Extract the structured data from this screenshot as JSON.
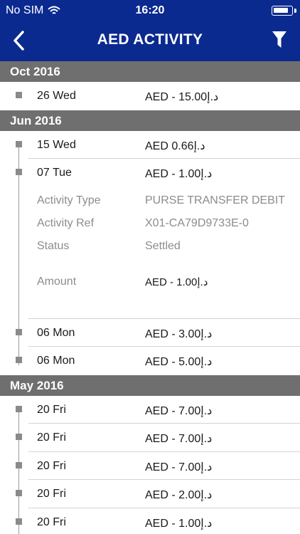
{
  "status_bar": {
    "carrier": "No SIM",
    "time": "16:20"
  },
  "header": {
    "title": "AED ACTIVITY"
  },
  "sections": [
    {
      "title": "Oct 2016",
      "rows": [
        {
          "date": "26 Wed",
          "amount": "AED - 15.00د.إ"
        }
      ]
    },
    {
      "title": "Jun 2016",
      "rows": [
        {
          "date": "15 Wed",
          "amount": "AED 0.66د.إ"
        },
        {
          "date": "07 Tue",
          "amount": "AED - 1.00د.إ"
        },
        {
          "date": "06 Mon",
          "amount": "AED - 3.00د.إ"
        },
        {
          "date": "06 Mon",
          "amount": "AED - 5.00د.إ"
        }
      ],
      "details": {
        "activity_type_label": "Activity Type",
        "activity_type_value": "PURSE TRANSFER DEBIT",
        "activity_ref_label": "Activity Ref",
        "activity_ref_value": "X01-CA79D9733E-0",
        "status_label": "Status",
        "status_value": "Settled",
        "amount_label": "Amount",
        "amount_value": "AED - 1.00د.إ"
      }
    },
    {
      "title": "May 2016",
      "rows": [
        {
          "date": "20 Fri",
          "amount": "AED - 7.00د.إ"
        },
        {
          "date": "20 Fri",
          "amount": "AED - 7.00د.إ"
        },
        {
          "date": "20 Fri",
          "amount": "AED - 7.00د.إ"
        },
        {
          "date": "20 Fri",
          "amount": "AED - 2.00د.إ"
        },
        {
          "date": "20 Fri",
          "amount": "AED - 1.00د.إ"
        }
      ]
    }
  ],
  "icons": {
    "wifi": "wifi-icon",
    "battery": "battery-icon",
    "back": "chevron-left-icon",
    "filter": "filter-icon",
    "bullet": "square-bullet-icon"
  },
  "colors": {
    "nav_background": "#0b2a8f",
    "section_header": "#6f6f6f",
    "detail_text": "#8c8c8c"
  }
}
